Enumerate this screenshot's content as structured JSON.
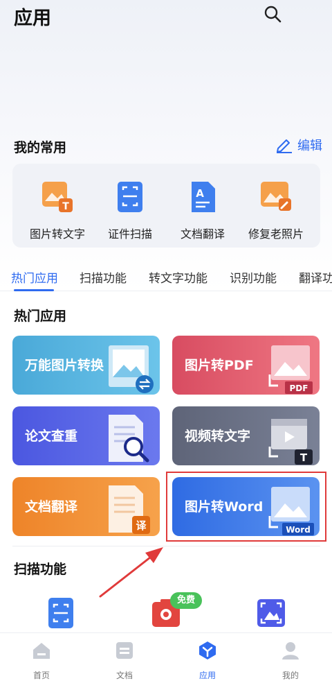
{
  "header": {
    "title": "应用",
    "search_icon": "search-icon"
  },
  "favorites": {
    "title": "我的常用",
    "edit_label": "编辑",
    "items": [
      {
        "label": "图片转文字",
        "icon": "image-to-text-icon"
      },
      {
        "label": "证件扫描",
        "icon": "id-scan-icon"
      },
      {
        "label": "文档翻译",
        "icon": "doc-translate-icon"
      },
      {
        "label": "修复老照片",
        "icon": "photo-repair-icon"
      }
    ]
  },
  "tabs": [
    {
      "label": "热门应用",
      "active": true
    },
    {
      "label": "扫描功能",
      "active": false
    },
    {
      "label": "转文字功能",
      "active": false
    },
    {
      "label": "识别功能",
      "active": false
    },
    {
      "label": "翻译功",
      "active": false
    }
  ],
  "hot": {
    "title": "热门应用",
    "tiles": [
      {
        "label": "万能图片转换",
        "color": "#4fb5de"
      },
      {
        "label": "图片转PDF",
        "color": "#e35f6f",
        "badge": "PDF"
      },
      {
        "label": "论文查重",
        "color": "#5463e6"
      },
      {
        "label": "视频转文字",
        "color": "#6b7186",
        "badge": "T"
      },
      {
        "label": "文档翻译",
        "color": "#f08c32",
        "badge": "译"
      },
      {
        "label": "图片转Word",
        "color": "#3b78e7",
        "badge": "Word"
      }
    ]
  },
  "scan": {
    "title": "扫描功能",
    "free_badge": "免费",
    "icons": [
      "doc-scan-icon",
      "camera-scan-icon",
      "image-scan-icon"
    ]
  },
  "bottom_nav": [
    {
      "label": "首页",
      "active": false
    },
    {
      "label": "文档",
      "active": false
    },
    {
      "label": "应用",
      "active": true
    },
    {
      "label": "我的",
      "active": false
    }
  ],
  "colors": {
    "accent": "#2f6bf0",
    "highlight": "#e03a3a",
    "free_badge": "#49c25a"
  }
}
